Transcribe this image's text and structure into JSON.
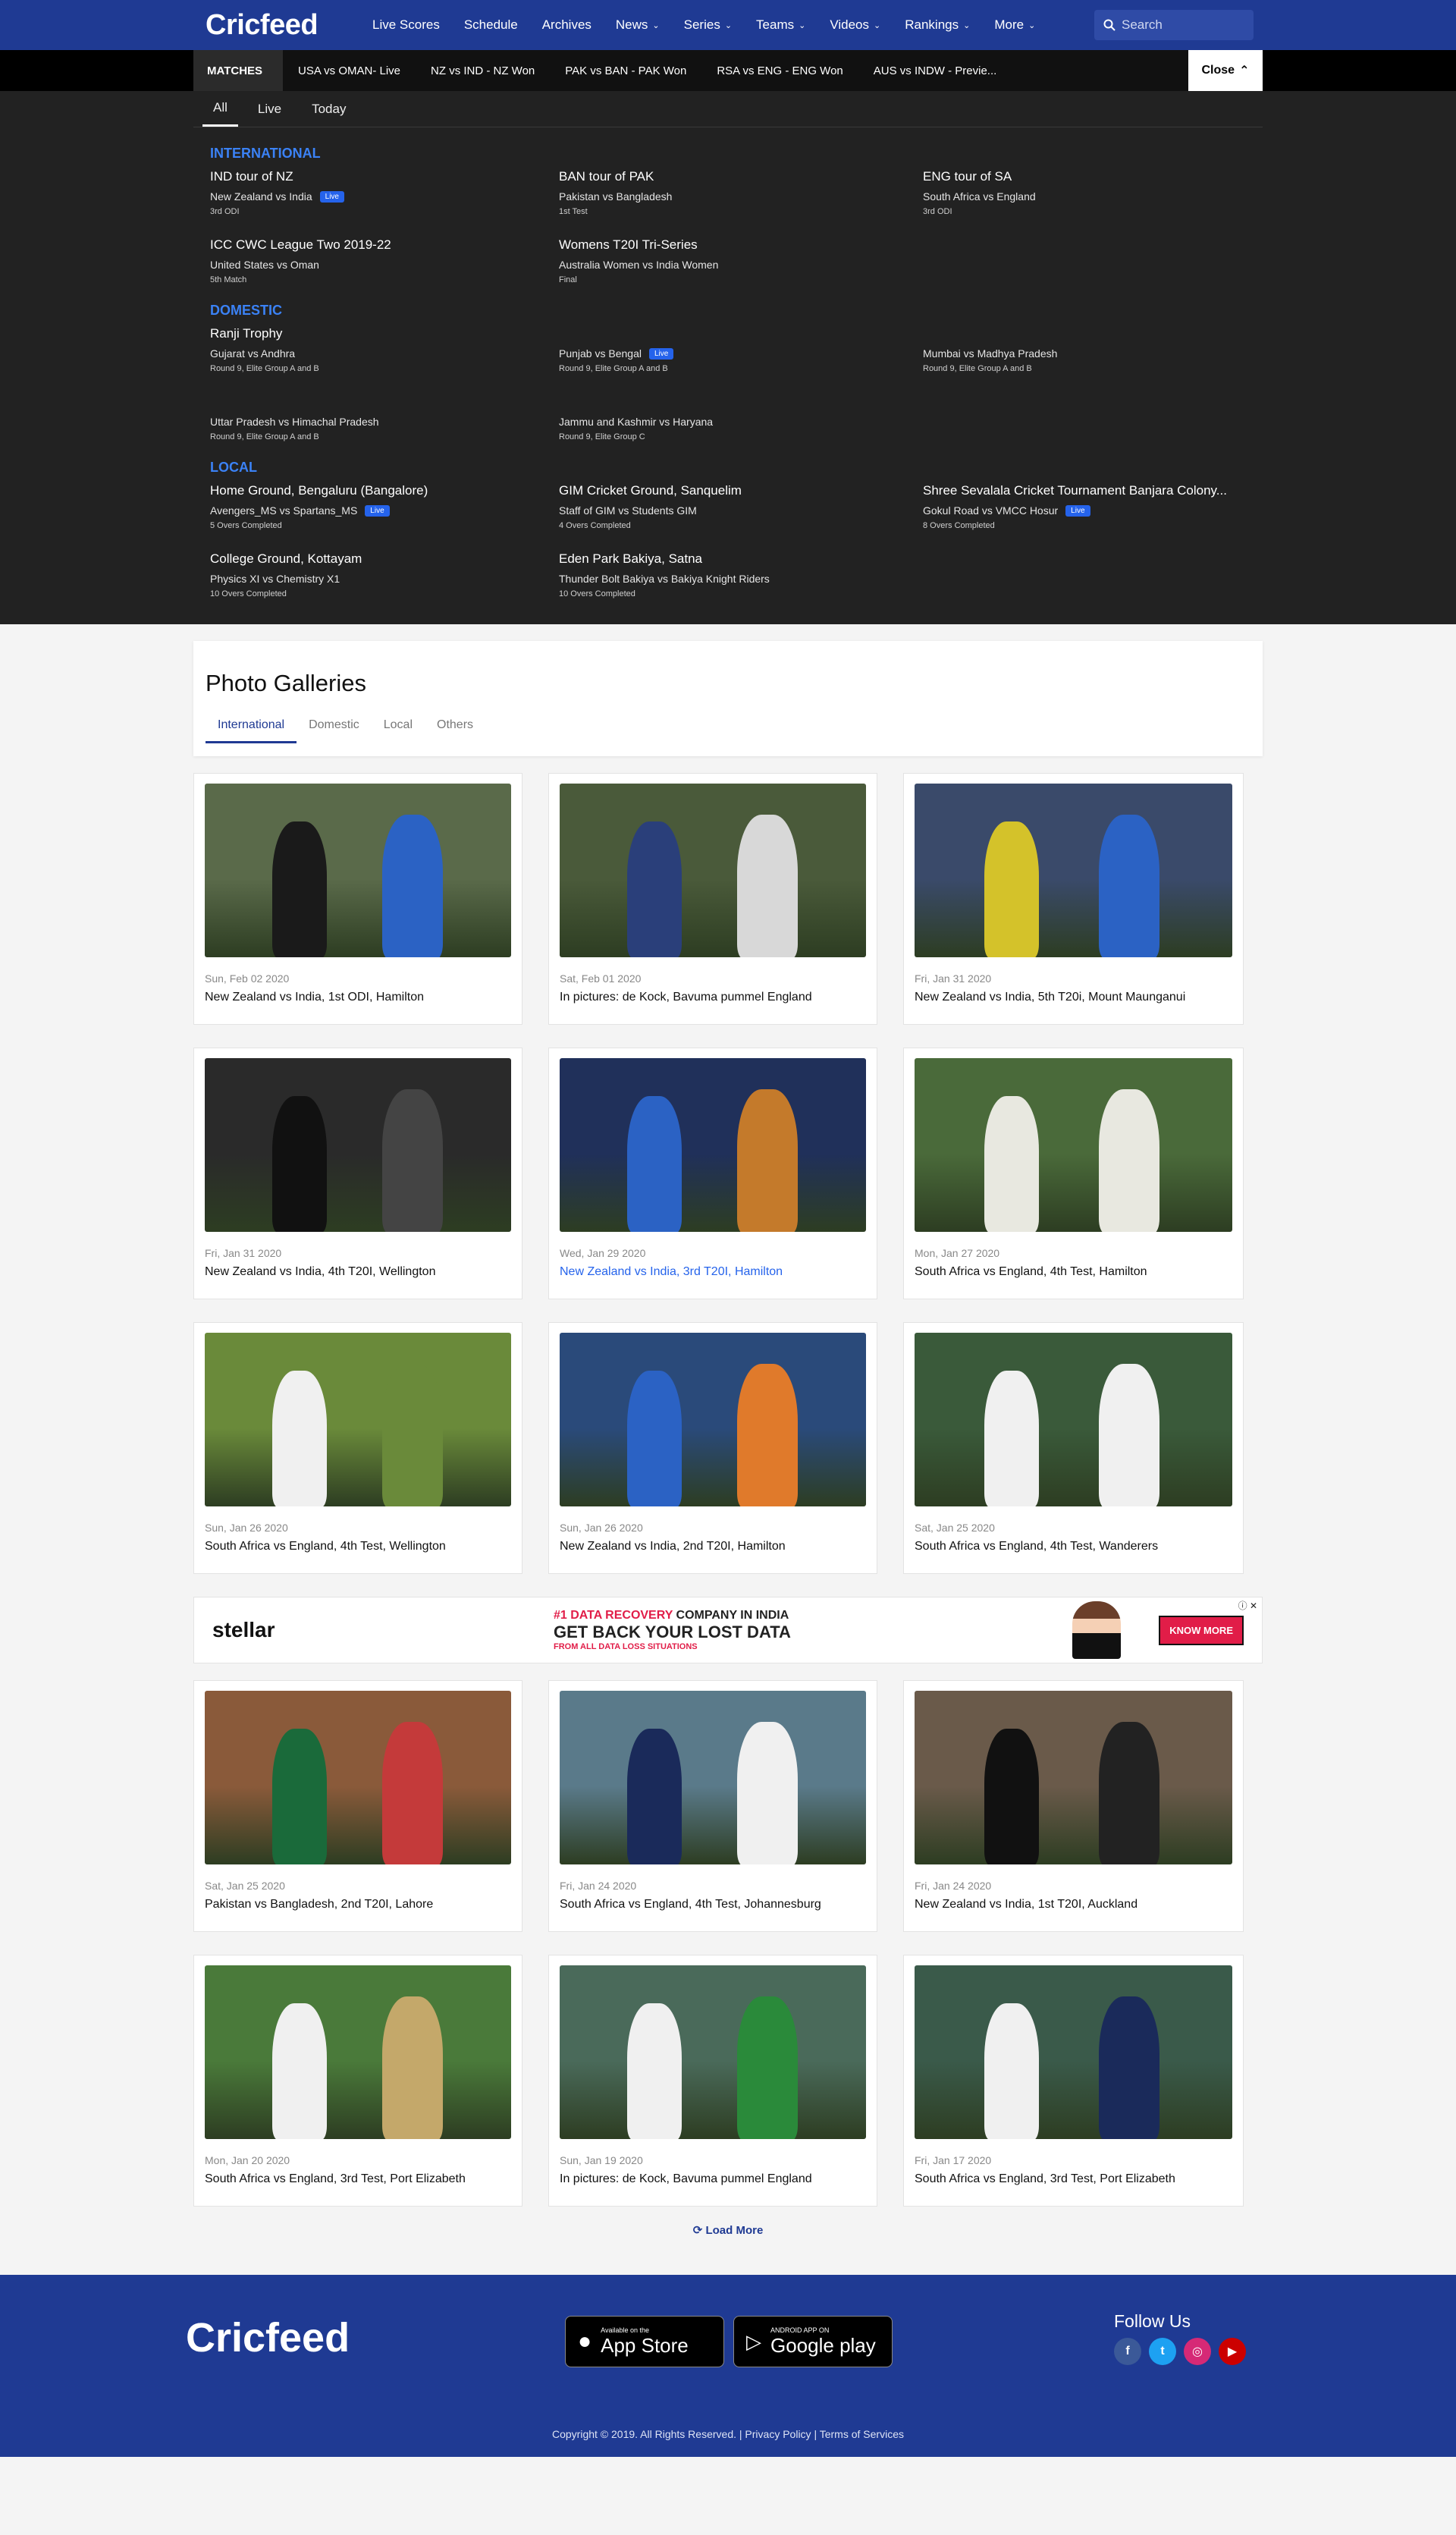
{
  "header": {
    "logo": "Cricfeed",
    "nav": [
      {
        "label": "Live Scores",
        "chev": false
      },
      {
        "label": "Schedule",
        "chev": false
      },
      {
        "label": "Archives",
        "chev": false
      },
      {
        "label": "News",
        "chev": true
      },
      {
        "label": "Series",
        "chev": true
      },
      {
        "label": "Teams",
        "chev": true
      },
      {
        "label": "Videos",
        "chev": true
      },
      {
        "label": "Rankings",
        "chev": true
      },
      {
        "label": "More",
        "chev": true
      }
    ],
    "search_placeholder": "Search"
  },
  "ticker": {
    "label": "MATCHES",
    "items": [
      "USA vs OMAN- Live",
      "NZ vs IND - NZ Won",
      "PAK vs BAN - PAK Won",
      "RSA vs ENG - ENG Won",
      "AUS vs INDW - Previe..."
    ],
    "close_label": "Close"
  },
  "panel": {
    "tabs": [
      "All",
      "Live",
      "Today"
    ],
    "sections": [
      {
        "title": "INTERNATIONAL",
        "matches": [
          {
            "series": "IND tour of NZ",
            "teams": "New Zealand vs India",
            "live": true,
            "note": "3rd ODI"
          },
          {
            "series": "BAN tour of PAK",
            "teams": "Pakistan vs Bangladesh",
            "live": false,
            "note": "1st Test"
          },
          {
            "series": "ENG tour of SA",
            "teams": "South Africa vs England",
            "live": false,
            "note": "3rd ODI"
          },
          {
            "series": "ICC CWC League Two 2019-22",
            "teams": "United States vs Oman",
            "live": false,
            "note": "5th Match"
          },
          {
            "series": "Womens T20I Tri-Series",
            "teams": "Australia Women vs India Women",
            "live": false,
            "note": "Final"
          }
        ]
      },
      {
        "title": "DOMESTIC",
        "matches": [
          {
            "series": "Ranji Trophy",
            "teams": "Gujarat vs Andhra",
            "live": false,
            "note": "Round 9, Elite Group A and B"
          },
          {
            "series": "",
            "teams": "Punjab vs Bengal",
            "live": true,
            "note": "Round 9, Elite Group A and B"
          },
          {
            "series": "",
            "teams": "Mumbai vs Madhya Pradesh",
            "live": false,
            "note": "Round 9, Elite Group A and B"
          },
          {
            "series": "",
            "teams": "Uttar Pradesh vs Himachal Pradesh",
            "live": false,
            "note": "Round 9, Elite Group A and B"
          },
          {
            "series": "",
            "teams": "Jammu and Kashmir vs Haryana",
            "live": false,
            "note": "Round 9, Elite Group C"
          }
        ]
      },
      {
        "title": "LOCAL",
        "matches": [
          {
            "series": "Home Ground, Bengaluru (Bangalore)",
            "teams": "Avengers_MS vs Spartans_MS",
            "live": true,
            "note": "5 Overs Completed"
          },
          {
            "series": "GIM Cricket Ground, Sanquelim",
            "teams": "Staff of GIM vs Students GIM",
            "live": false,
            "note": "4 Overs Completed"
          },
          {
            "series": "Shree Sevalala Cricket Tournament Banjara Colony...",
            "teams": "Gokul Road vs VMCC Hosur",
            "live": true,
            "note": "8 Overs Completed"
          },
          {
            "series": "College Ground, Kottayam",
            "teams": "Physics XI vs Chemistry X1",
            "live": false,
            "note": "10 Overs Completed"
          },
          {
            "series": "Eden Park Bakiya, Satna",
            "teams": "Thunder Bolt Bakiya vs Bakiya Knight Riders",
            "live": false,
            "note": "10 Overs Completed"
          }
        ]
      }
    ],
    "live_label": "Live"
  },
  "gallery": {
    "title": "Photo Galleries",
    "tabs": [
      "International",
      "Domestic",
      "Local",
      "Others"
    ],
    "cards_top": [
      {
        "date": "Sun, Feb 02 2020",
        "title": "New Zealand vs India, 1st ODI, Hamilton",
        "bg": "#5a6a4a",
        "c1": "#1a1a1a",
        "c2": "#2b62c4"
      },
      {
        "date": "Sat, Feb 01 2020",
        "title": "In pictures: de Kock, Bavuma pummel England",
        "bg": "#4a5a3a",
        "c1": "#2a3f7a",
        "c2": "#d8d8d8"
      },
      {
        "date": "Fri, Jan 31 2020",
        "title": "New Zealand vs India, 5th T20i, Mount Maunganui",
        "bg": "#3a4a6a",
        "c1": "#d4c22a",
        "c2": "#2b62c4"
      },
      {
        "date": "Fri, Jan 31 2020",
        "title": "New Zealand vs India, 4th T20I, Wellington",
        "bg": "#2a2a2a",
        "c1": "#111111",
        "c2": "#444444"
      },
      {
        "date": "Wed, Jan 29 2020",
        "title": "New Zealand vs India, 3rd T20I, Hamilton",
        "bg": "#20305a",
        "c1": "#2b62c4",
        "c2": "#c47a2b",
        "hover": true
      },
      {
        "date": "Mon, Jan 27 2020",
        "title": "South Africa vs England, 4th Test, Hamilton",
        "bg": "#4a6a3a",
        "c1": "#e8e8e0",
        "c2": "#e8e8e0"
      },
      {
        "date": "Sun, Jan 26 2020",
        "title": "South Africa vs England, 4th Test, Wellington",
        "bg": "#6a8a3a",
        "c1": "#f0f0f0",
        "c2": "#6a8a3a"
      },
      {
        "date": "Sun, Jan 26 2020",
        "title": "New Zealand vs India, 2nd T20I, Hamilton",
        "bg": "#2a4a7a",
        "c1": "#2b62c4",
        "c2": "#e07a2b"
      },
      {
        "date": "Sat, Jan 25 2020",
        "title": "South Africa vs England, 4th Test, Wanderers",
        "bg": "#3a5a3a",
        "c1": "#f0f0f0",
        "c2": "#f0f0f0"
      }
    ],
    "cards_bottom": [
      {
        "date": "Sat, Jan 25 2020",
        "title": "Pakistan vs Bangladesh, 2nd T20I, Lahore",
        "bg": "#8a5a3a",
        "c1": "#1a6a3a",
        "c2": "#c43a3a"
      },
      {
        "date": "Fri, Jan 24 2020",
        "title": "South Africa vs England, 4th Test, Johannesburg",
        "bg": "#5a7a8a",
        "c1": "#1a2a5a",
        "c2": "#f0f0f0"
      },
      {
        "date": "Fri, Jan 24 2020",
        "title": "New Zealand vs India, 1st T20I, Auckland",
        "bg": "#6a5a4a",
        "c1": "#111111",
        "c2": "#222222"
      },
      {
        "date": "Mon, Jan 20 2020",
        "title": "South Africa vs England, 3rd Test, Port Elizabeth",
        "bg": "#4a7a3a",
        "c1": "#f0f0f0",
        "c2": "#c4a86a"
      },
      {
        "date": "Sun, Jan 19 2020",
        "title": "In pictures: de Kock, Bavuma pummel England",
        "bg": "#4a6a5a",
        "c1": "#f0f0f0",
        "c2": "#2a8a3a"
      },
      {
        "date": "Fri, Jan 17 2020",
        "title": "South Africa vs England, 3rd Test, Port Elizabeth",
        "bg": "#3a5a4a",
        "c1": "#f0f0f0",
        "c2": "#1a2a5a"
      }
    ],
    "load_more": "Load More"
  },
  "ad": {
    "brand": "stellar",
    "line1_accent": "#1 DATA RECOVERY",
    "line1_rest": " COMPANY IN INDIA",
    "line2": "GET BACK YOUR LOST DATA",
    "line3": "FROM ALL DATA LOSS SITUATIONS",
    "cta": "KNOW MORE"
  },
  "footer": {
    "logo": "Cricfeed",
    "app_store_small": "Available on the",
    "app_store": "App Store",
    "play_small": "ANDROID APP ON",
    "play": "Google play",
    "follow": "Follow Us",
    "social": [
      {
        "icon": "facebook-icon",
        "glyph": "f",
        "color": "#3b5998"
      },
      {
        "icon": "twitter-icon",
        "glyph": "t",
        "color": "#1da1f2"
      },
      {
        "icon": "instagram-icon",
        "glyph": "◎",
        "color": "#d62976"
      },
      {
        "icon": "youtube-icon",
        "glyph": "▶",
        "color": "#cc0000"
      }
    ],
    "copyright": "Copyright © 2019. All Rights Reserved.",
    "privacy": "Privacy Policy",
    "terms": "Terms of Services"
  }
}
